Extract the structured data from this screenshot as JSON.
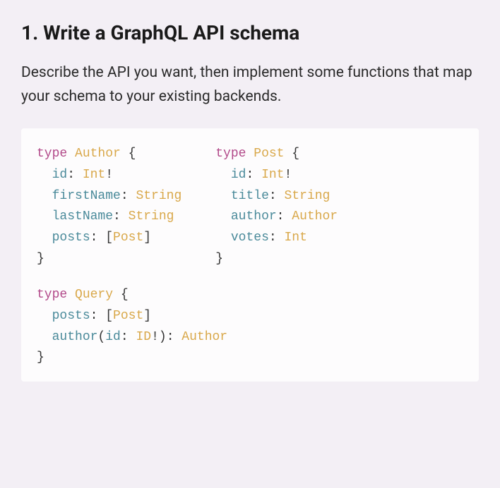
{
  "heading": "1. Write a GraphQL API schema",
  "description": "Describe the API you want, then implement some functions that map your schema to your existing backends.",
  "code": {
    "author": {
      "keyword": "type",
      "name": "Author",
      "open": " {",
      "fields": {
        "id": {
          "name": "id",
          "sep": ": ",
          "type": "Int",
          "bang": "!"
        },
        "firstName": {
          "name": "firstName",
          "sep": ": ",
          "type": "String"
        },
        "lastName": {
          "name": "lastName",
          "sep": ": ",
          "type": "String"
        },
        "posts": {
          "name": "posts",
          "sep": ": ",
          "lbrack": "[",
          "type": "Post",
          "rbrack": "]"
        }
      },
      "close": "}"
    },
    "post": {
      "keyword": "type",
      "name": "Post",
      "open": " {",
      "fields": {
        "id": {
          "name": "id",
          "sep": ": ",
          "type": "Int",
          "bang": "!"
        },
        "title": {
          "name": "title",
          "sep": ": ",
          "type": "String"
        },
        "author": {
          "name": "author",
          "sep": ": ",
          "type": "Author"
        },
        "votes": {
          "name": "votes",
          "sep": ": ",
          "type": "Int"
        }
      },
      "close": "}"
    },
    "query": {
      "keyword": "type",
      "name": "Query",
      "open": " {",
      "fields": {
        "posts": {
          "name": "posts",
          "sep": ": ",
          "lbrack": "[",
          "type": "Post",
          "rbrack": "]"
        },
        "author": {
          "name": "author",
          "lparen": "(",
          "arg": "id",
          "argsep": ": ",
          "argtype": "ID",
          "bang": "!",
          "rparen": ")",
          "sep": ": ",
          "type": "Author"
        }
      },
      "close": "}"
    }
  }
}
